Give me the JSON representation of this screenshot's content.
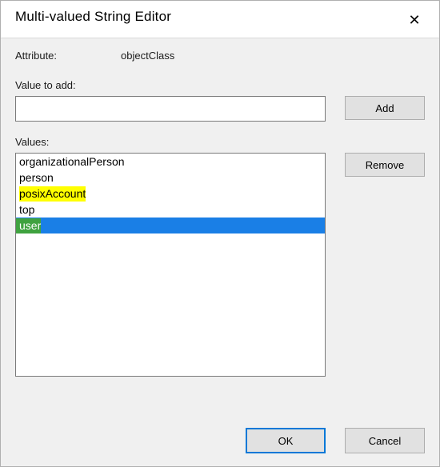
{
  "window": {
    "title": "Multi-valued String Editor",
    "close_glyph": "✕"
  },
  "labels": {
    "attribute": "Attribute:",
    "value_to_add": "Value to add:",
    "values": "Values:"
  },
  "attribute_name": "objectClass",
  "input": {
    "value": "",
    "placeholder": ""
  },
  "buttons": {
    "add": "Add",
    "remove": "Remove",
    "ok": "OK",
    "cancel": "Cancel"
  },
  "values_list": [
    {
      "text": "organizationalPerson",
      "highlight": "none",
      "selected": false
    },
    {
      "text": "person",
      "highlight": "none",
      "selected": false
    },
    {
      "text": "posixAccount",
      "highlight": "yellow",
      "selected": false
    },
    {
      "text": "top",
      "highlight": "none",
      "selected": false
    },
    {
      "text": "user",
      "highlight": "green",
      "selected": true
    }
  ]
}
